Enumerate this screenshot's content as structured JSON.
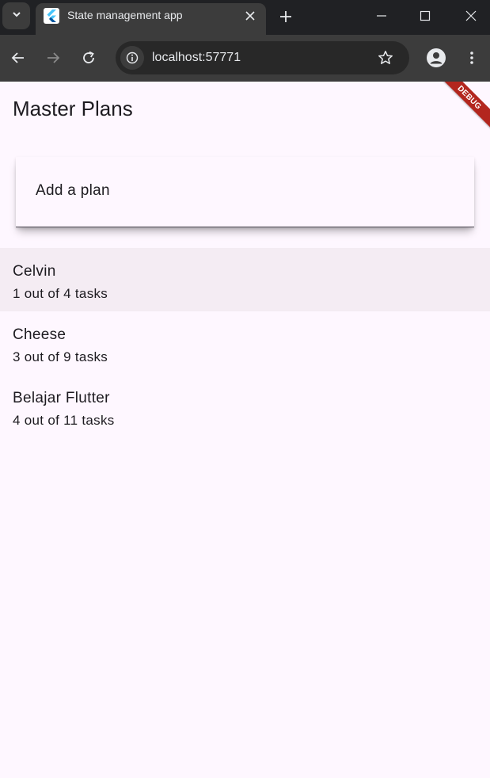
{
  "browser": {
    "tab_title": "State management app",
    "url": "localhost:57771"
  },
  "app": {
    "title": "Master Plans",
    "debug_banner": "DEBUG",
    "add_plan_placeholder": "Add a plan",
    "plans": [
      {
        "name": "Celvin",
        "progress": "1 out of 4 tasks"
      },
      {
        "name": "Cheese",
        "progress": "3 out of 9 tasks"
      },
      {
        "name": "Belajar Flutter",
        "progress": "4 out of 11 tasks"
      }
    ]
  },
  "colors": {
    "background": "#fef7ff",
    "selected_row": "#f4ecf3",
    "debug_banner": "#b3261e"
  }
}
